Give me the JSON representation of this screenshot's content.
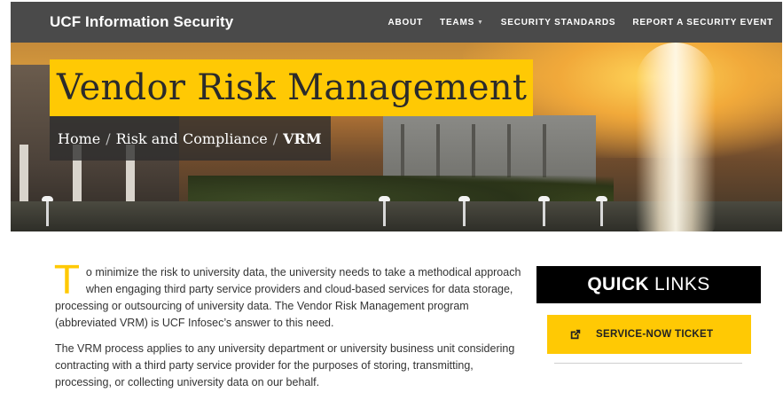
{
  "nav": {
    "brand": "UCF Information Security",
    "links": [
      {
        "label": "ABOUT"
      },
      {
        "label": "TEAMS",
        "has_dropdown": true
      },
      {
        "label": "SECURITY STANDARDS"
      },
      {
        "label": "REPORT A SECURITY EVENT"
      }
    ]
  },
  "hero": {
    "title": "Vendor Risk Management",
    "breadcrumb": {
      "home": "Home",
      "section": "Risk and Compliance",
      "current": "VRM",
      "separator": "/"
    }
  },
  "content": {
    "dropcap": "T",
    "paragraph1": "o minimize the risk to university data, the university needs to take a methodical approach when engaging third party service providers and cloud-based services for data storage, processing or outsourcing of university data. The Vendor Risk Management program (abbreviated VRM) is UCF Infosec’s answer to this need.",
    "paragraph2": "The VRM process applies to any university department or university business unit considering contracting with a third party service provider for the purposes of storing, transmitting, processing, or collecting university data on our behalf."
  },
  "sidebar": {
    "quick_links_bold": "QUICK",
    "quick_links_rest": "LINKS",
    "ticket_label": "SERVICE-NOW TICKET",
    "ticket_icon": "external-link-icon"
  },
  "colors": {
    "nav_bg": "#4a4a4a",
    "accent_gold": "#ffc904",
    "black": "#000000",
    "body_text": "#333333"
  }
}
